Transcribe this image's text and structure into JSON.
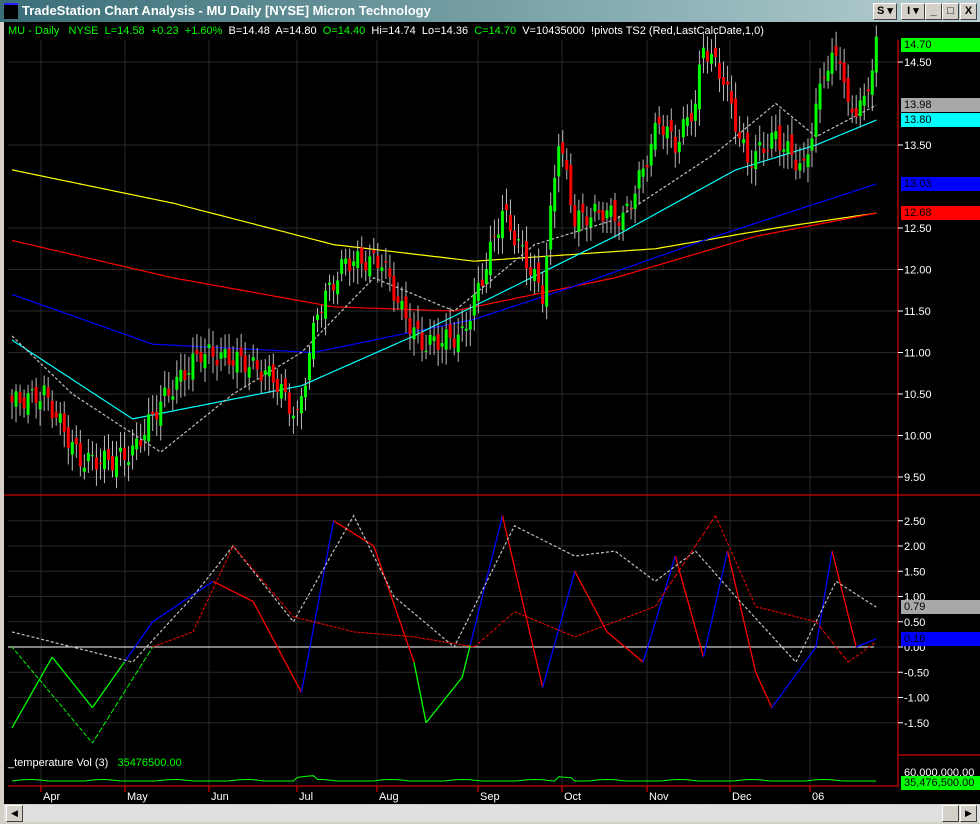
{
  "window": {
    "title": "TradeStation Chart Analysis - MU  Daily  [NYSE] Micron Technology",
    "buttons": [
      "S ▾",
      "I ▾",
      "_",
      "□",
      "X"
    ]
  },
  "status": {
    "symbol": "MU - Daily",
    "exchange": "NYSE",
    "last": "L=14.58",
    "change": "+0.23",
    "pct": "+1.60%",
    "bid": "B=14.48",
    "ask": "A=14.80",
    "open": "O=14.40",
    "high": "Hi=14.74",
    "low": "Lo=14.36",
    "close": "C=14.70",
    "volume": "V=10435000",
    "study": "!pivots TS2  (Red,LastCalcDate,1,0)"
  },
  "price_axis": {
    "ticks": [
      "14.50",
      "13.50",
      "12.50",
      "12.00",
      "11.50",
      "11.00",
      "10.50",
      "10.00",
      "9.50"
    ],
    "tick_values": [
      14.5,
      13.5,
      12.5,
      12.0,
      11.5,
      11.0,
      10.5,
      10.0,
      9.5
    ],
    "labels": [
      {
        "v": "14.70",
        "val": 14.7,
        "color": "#00ff00"
      },
      {
        "v": "13.98",
        "val": 13.98,
        "color": "#a8a8a8"
      },
      {
        "v": "13.80",
        "val": 13.8,
        "color": "#00ffff"
      },
      {
        "v": "13.03",
        "val": 13.03,
        "color": "#0000ff"
      },
      {
        "v": "12.68",
        "val": 12.68,
        "color": "#ff0000"
      }
    ]
  },
  "osc_axis": {
    "ticks": [
      "2.50",
      "2.00",
      "1.50",
      "1.00",
      "0.50",
      "0.00",
      "-0.50",
      "-1.00",
      "-1.50"
    ],
    "tick_values": [
      2.5,
      2,
      1.5,
      1,
      0.5,
      0,
      -0.5,
      -1,
      -1.5
    ],
    "labels": [
      {
        "v": "0.79",
        "val": 0.79,
        "color": "#a8a8a8"
      },
      {
        "v": "0.16",
        "val": 0.16,
        "color": "#0000ff"
      }
    ]
  },
  "volume": {
    "label": "_temperature Vol  (3)",
    "value": "35476500.00",
    "axis_top": "60,000,000.00",
    "axis_label": "35,476,500.00"
  },
  "months": [
    "Apr",
    "May",
    "Jun",
    "Jul",
    "Aug",
    "Sep",
    "Oct",
    "Nov",
    "Dec",
    "06"
  ],
  "chart_data": {
    "type": "candlestick",
    "note": "approximate keypoints [bar index, value]",
    "close": [
      [
        0,
        10.4
      ],
      [
        8,
        10.5
      ],
      [
        17,
        9.7
      ],
      [
        25,
        9.7
      ],
      [
        30,
        9.8
      ],
      [
        37,
        10.4
      ],
      [
        47,
        11.0
      ],
      [
        57,
        10.9
      ],
      [
        65,
        10.7
      ],
      [
        71,
        10.2
      ],
      [
        76,
        11.5
      ],
      [
        83,
        12.1
      ],
      [
        92,
        12.1
      ],
      [
        97,
        11.5
      ],
      [
        102,
        11.1
      ],
      [
        112,
        11.2
      ],
      [
        117,
        11.9
      ],
      [
        122,
        12.7
      ],
      [
        127,
        12.2
      ],
      [
        132,
        11.7
      ],
      [
        136,
        13.6
      ],
      [
        140,
        12.6
      ],
      [
        147,
        12.7
      ],
      [
        152,
        12.6
      ],
      [
        157,
        13.2
      ],
      [
        161,
        13.8
      ],
      [
        165,
        13.5
      ],
      [
        170,
        14.0
      ],
      [
        172,
        14.7
      ],
      [
        177,
        14.3
      ],
      [
        181,
        13.6
      ],
      [
        183,
        13.3
      ],
      [
        190,
        13.6
      ],
      [
        197,
        13.2
      ],
      [
        202,
        14.4
      ],
      [
        206,
        14.6
      ],
      [
        208,
        13.9
      ],
      [
        212,
        14.0
      ],
      [
        215,
        14.7
      ]
    ],
    "ma_yellow": [
      [
        0,
        13.2
      ],
      [
        40,
        12.8
      ],
      [
        80,
        12.3
      ],
      [
        115,
        12.1
      ],
      [
        160,
        12.25
      ],
      [
        190,
        12.5
      ],
      [
        215,
        12.68
      ]
    ],
    "ma_red": [
      [
        0,
        12.35
      ],
      [
        40,
        11.9
      ],
      [
        80,
        11.55
      ],
      [
        110,
        11.5
      ],
      [
        150,
        11.9
      ],
      [
        185,
        12.4
      ],
      [
        215,
        12.68
      ]
    ],
    "ma_blue": [
      [
        0,
        11.7
      ],
      [
        35,
        11.1
      ],
      [
        75,
        11.0
      ],
      [
        115,
        11.4
      ],
      [
        140,
        11.8
      ],
      [
        175,
        12.4
      ],
      [
        215,
        13.03
      ]
    ],
    "ma_cyan": [
      [
        0,
        11.15
      ],
      [
        30,
        10.2
      ],
      [
        72,
        10.6
      ],
      [
        100,
        11.2
      ],
      [
        125,
        11.8
      ],
      [
        150,
        12.4
      ],
      [
        180,
        13.2
      ],
      [
        200,
        13.5
      ],
      [
        215,
        13.8
      ]
    ],
    "ma_dash": [
      [
        0,
        11.2
      ],
      [
        15,
        10.5
      ],
      [
        37,
        9.8
      ],
      [
        55,
        10.5
      ],
      [
        72,
        11.0
      ],
      [
        90,
        11.9
      ],
      [
        110,
        11.5
      ],
      [
        130,
        12.3
      ],
      [
        150,
        12.6
      ],
      [
        175,
        13.4
      ],
      [
        190,
        14.0
      ],
      [
        200,
        13.6
      ],
      [
        215,
        13.98
      ]
    ],
    "osc_blue": [
      [
        0,
        -1.6
      ],
      [
        10,
        -0.2
      ],
      [
        20,
        -1.2
      ],
      [
        35,
        0.5
      ],
      [
        50,
        1.3
      ],
      [
        60,
        0.9
      ],
      [
        72,
        -0.9
      ],
      [
        80,
        2.5
      ],
      [
        90,
        2.0
      ],
      [
        100,
        -0.3
      ],
      [
        103,
        -1.5
      ],
      [
        112,
        -0.6
      ],
      [
        122,
        2.6
      ],
      [
        132,
        -0.8
      ],
      [
        140,
        1.5
      ],
      [
        148,
        0.3
      ],
      [
        157,
        -0.3
      ],
      [
        165,
        1.8
      ],
      [
        172,
        -0.2
      ],
      [
        178,
        1.9
      ],
      [
        185,
        -0.5
      ],
      [
        189,
        -1.2
      ],
      [
        200,
        0.0
      ],
      [
        204,
        1.9
      ],
      [
        210,
        0.0
      ],
      [
        215,
        0.16
      ]
    ],
    "osc_red": [
      [
        0,
        -1.6
      ],
      [
        10,
        -0.2
      ],
      [
        20,
        -1.2
      ],
      [
        35,
        0.5
      ],
      [
        50,
        1.3
      ],
      [
        60,
        0.9
      ],
      [
        72,
        -0.9
      ],
      [
        80,
        2.5
      ],
      [
        90,
        2.0
      ],
      [
        100,
        -0.3
      ],
      [
        103,
        -1.5
      ],
      [
        112,
        -0.6
      ],
      [
        122,
        2.6
      ],
      [
        132,
        -0.8
      ],
      [
        140,
        1.5
      ],
      [
        148,
        0.3
      ],
      [
        157,
        -0.3
      ],
      [
        165,
        1.8
      ],
      [
        172,
        -0.2
      ],
      [
        178,
        1.9
      ],
      [
        185,
        -0.5
      ],
      [
        189,
        -1.2
      ],
      [
        200,
        0.0
      ],
      [
        204,
        1.9
      ],
      [
        210,
        0.0
      ],
      [
        215,
        0.16
      ]
    ],
    "osc_dash_white": [
      [
        0,
        0.3
      ],
      [
        15,
        0.0
      ],
      [
        30,
        -0.3
      ],
      [
        45,
        1.0
      ],
      [
        55,
        2.0
      ],
      [
        70,
        0.5
      ],
      [
        85,
        2.6
      ],
      [
        95,
        1.0
      ],
      [
        110,
        0.0
      ],
      [
        125,
        2.4
      ],
      [
        140,
        1.8
      ],
      [
        150,
        1.9
      ],
      [
        160,
        1.3
      ],
      [
        170,
        1.9
      ],
      [
        180,
        1.0
      ],
      [
        195,
        -0.3
      ],
      [
        205,
        1.3
      ],
      [
        215,
        0.79
      ]
    ],
    "osc_dash_red": [
      [
        0,
        0.0
      ],
      [
        20,
        -1.9
      ],
      [
        35,
        0.0
      ],
      [
        45,
        0.3
      ],
      [
        55,
        2.0
      ],
      [
        70,
        0.6
      ],
      [
        85,
        0.3
      ],
      [
        100,
        0.2
      ],
      [
        115,
        0.0
      ],
      [
        125,
        0.7
      ],
      [
        140,
        0.2
      ],
      [
        160,
        0.8
      ],
      [
        175,
        2.6
      ],
      [
        185,
        0.8
      ],
      [
        200,
        0.5
      ],
      [
        208,
        -0.3
      ],
      [
        215,
        0.1
      ]
    ]
  }
}
